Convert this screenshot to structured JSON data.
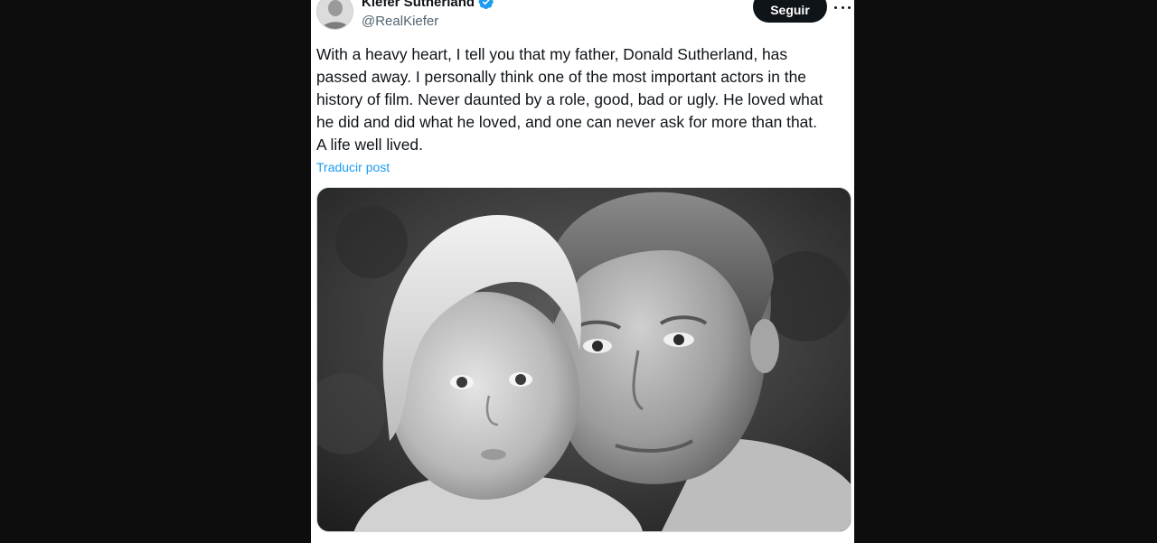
{
  "post": {
    "author_name": "Kiefer Sutherland",
    "author_handle": "@RealKiefer",
    "verified": true,
    "follow_label": "Seguir",
    "more_icon": "more-horizontal-icon",
    "text": "With a heavy heart, I tell you that my father, Donald Sutherland, has\npassed away. I personally think one of the most important actors in the\nhistory of film. Never daunted by a role, good, bad or ugly. He loved what\nhe did and did what he loved, and one can never ask for more than that.\nA life well lived.",
    "translate_label": "Traducir post"
  },
  "colors": {
    "page_background": "#0d0d0d",
    "card_background": "#ffffff",
    "text_primary": "#0f1419",
    "text_secondary": "#536471",
    "link": "#1d9bf0",
    "verified_badge": "#1d9bf0",
    "follow_button_bg": "#0f1419"
  }
}
